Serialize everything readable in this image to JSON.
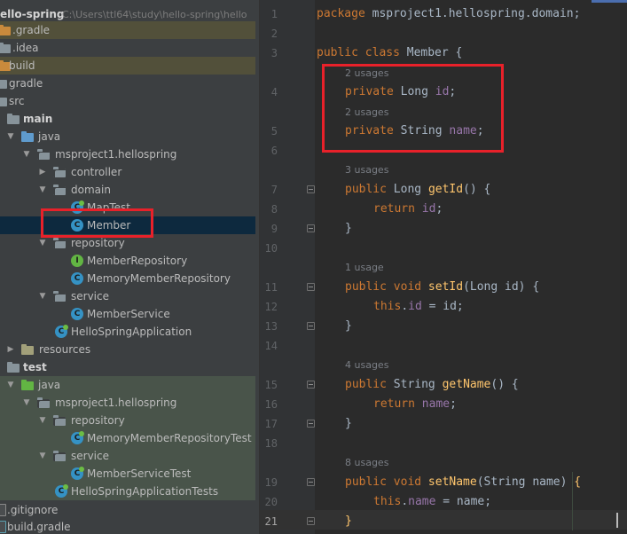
{
  "project_tree": {
    "project_name": "ello-spring",
    "project_path": "C:\\Users\\ttl64\\study\\hello-spring\\hello",
    "items": [
      {
        "label": ".gradle",
        "icon": "folder-icon",
        "excluded": true
      },
      {
        "label": ".idea",
        "icon": "folder-icon"
      },
      {
        "label": "build",
        "icon": "folder-icon",
        "excluded": true
      },
      {
        "label": "gradle",
        "icon": "folder-icon"
      },
      {
        "label": "src",
        "icon": "folder-icon"
      },
      {
        "label": "main",
        "icon": "folder-icon",
        "bold": true
      },
      {
        "label": "java",
        "icon": "source-folder-icon"
      },
      {
        "label": "msproject1.hellospring",
        "icon": "package-icon"
      },
      {
        "label": "controller",
        "icon": "package-icon"
      },
      {
        "label": "domain",
        "icon": "package-icon"
      },
      {
        "label": "MapTest",
        "icon": "class-icon"
      },
      {
        "label": "Member",
        "icon": "class-icon",
        "selected": true
      },
      {
        "label": "repository",
        "icon": "package-icon"
      },
      {
        "label": "MemberRepository",
        "icon": "interface-icon"
      },
      {
        "label": "MemoryMemberRepository",
        "icon": "class-icon"
      },
      {
        "label": "service",
        "icon": "package-icon"
      },
      {
        "label": "MemberService",
        "icon": "class-icon"
      },
      {
        "label": "HelloSpringApplication",
        "icon": "spring-class-icon"
      },
      {
        "label": "resources",
        "icon": "resources-folder-icon"
      },
      {
        "label": "test",
        "icon": "folder-icon",
        "bold": true
      },
      {
        "label": "java",
        "icon": "test-source-folder-icon",
        "test": true
      },
      {
        "label": "msproject1.hellospring",
        "icon": "package-icon",
        "test": true
      },
      {
        "label": "repository",
        "icon": "package-icon",
        "test": true
      },
      {
        "label": "MemoryMemberRepositoryTest",
        "icon": "test-class-icon",
        "test": true
      },
      {
        "label": "service",
        "icon": "package-icon",
        "test": true
      },
      {
        "label": "MemberServiceTest",
        "icon": "test-class-icon",
        "test": true
      },
      {
        "label": "HelloSpringApplicationTests",
        "icon": "test-class-icon",
        "test": true
      },
      {
        "label": ".gitignore",
        "icon": "file-icon"
      },
      {
        "label": "build.gradle",
        "icon": "gradle-file-icon"
      }
    ],
    "icon_letters": {
      "class": "C",
      "interface": "I"
    }
  },
  "editor": {
    "line_numbers": [
      "1",
      "2",
      "3",
      "4",
      "5",
      "6",
      "7",
      "8",
      "9",
      "10",
      "11",
      "12",
      "13",
      "14",
      "15",
      "16",
      "17",
      "18",
      "19",
      "20",
      "21"
    ],
    "current_line": "21",
    "usages": {
      "id_field": "2 usages",
      "name_field": "2 usages",
      "getId": "3 usages",
      "setId": "1 usage",
      "getName": "4 usages",
      "setName": "8 usages"
    },
    "code": {
      "l1_kw": "package",
      "l1_rest": " msproject1.hellospring.domain;",
      "l3_kw": "public class",
      "l3_rest": " Member {",
      "l4_kw": "private",
      "l4_type": " Long ",
      "l4_field": "id",
      "l4_end": ";",
      "l5_kw": "private",
      "l5_type": " String ",
      "l5_field": "name",
      "l5_end": ";",
      "l7_kw": "public",
      "l7_type": " Long ",
      "l7_method": "getId",
      "l7_end": "() {",
      "l8_kw": "return",
      "l8_field": "id",
      "l8_end": ";",
      "close_brace": "}",
      "l11_kw": "public void",
      "l11_method": "setId",
      "l11_end": "(Long id) {",
      "l12_kw": "this",
      "l12_dot": ".",
      "l12_field": "id",
      "l12_end": " = id;",
      "l15_kw": "public",
      "l15_type": " String ",
      "l15_method": "getName",
      "l15_end": "() {",
      "l16_kw": "return",
      "l16_field": "name",
      "l16_end": ";",
      "l19_kw": "public void",
      "l19_method": "setName",
      "l19_params": "(String name) ",
      "l19_brace": "{",
      "l20_kw": "this",
      "l20_dot": ".",
      "l20_field": "name",
      "l20_end": " = name;",
      "l21_brace": "}"
    }
  },
  "colors": {
    "keyword": "#cc7832",
    "field": "#9876aa",
    "method": "#ffc66d",
    "highlight_box": "#e8212a"
  }
}
